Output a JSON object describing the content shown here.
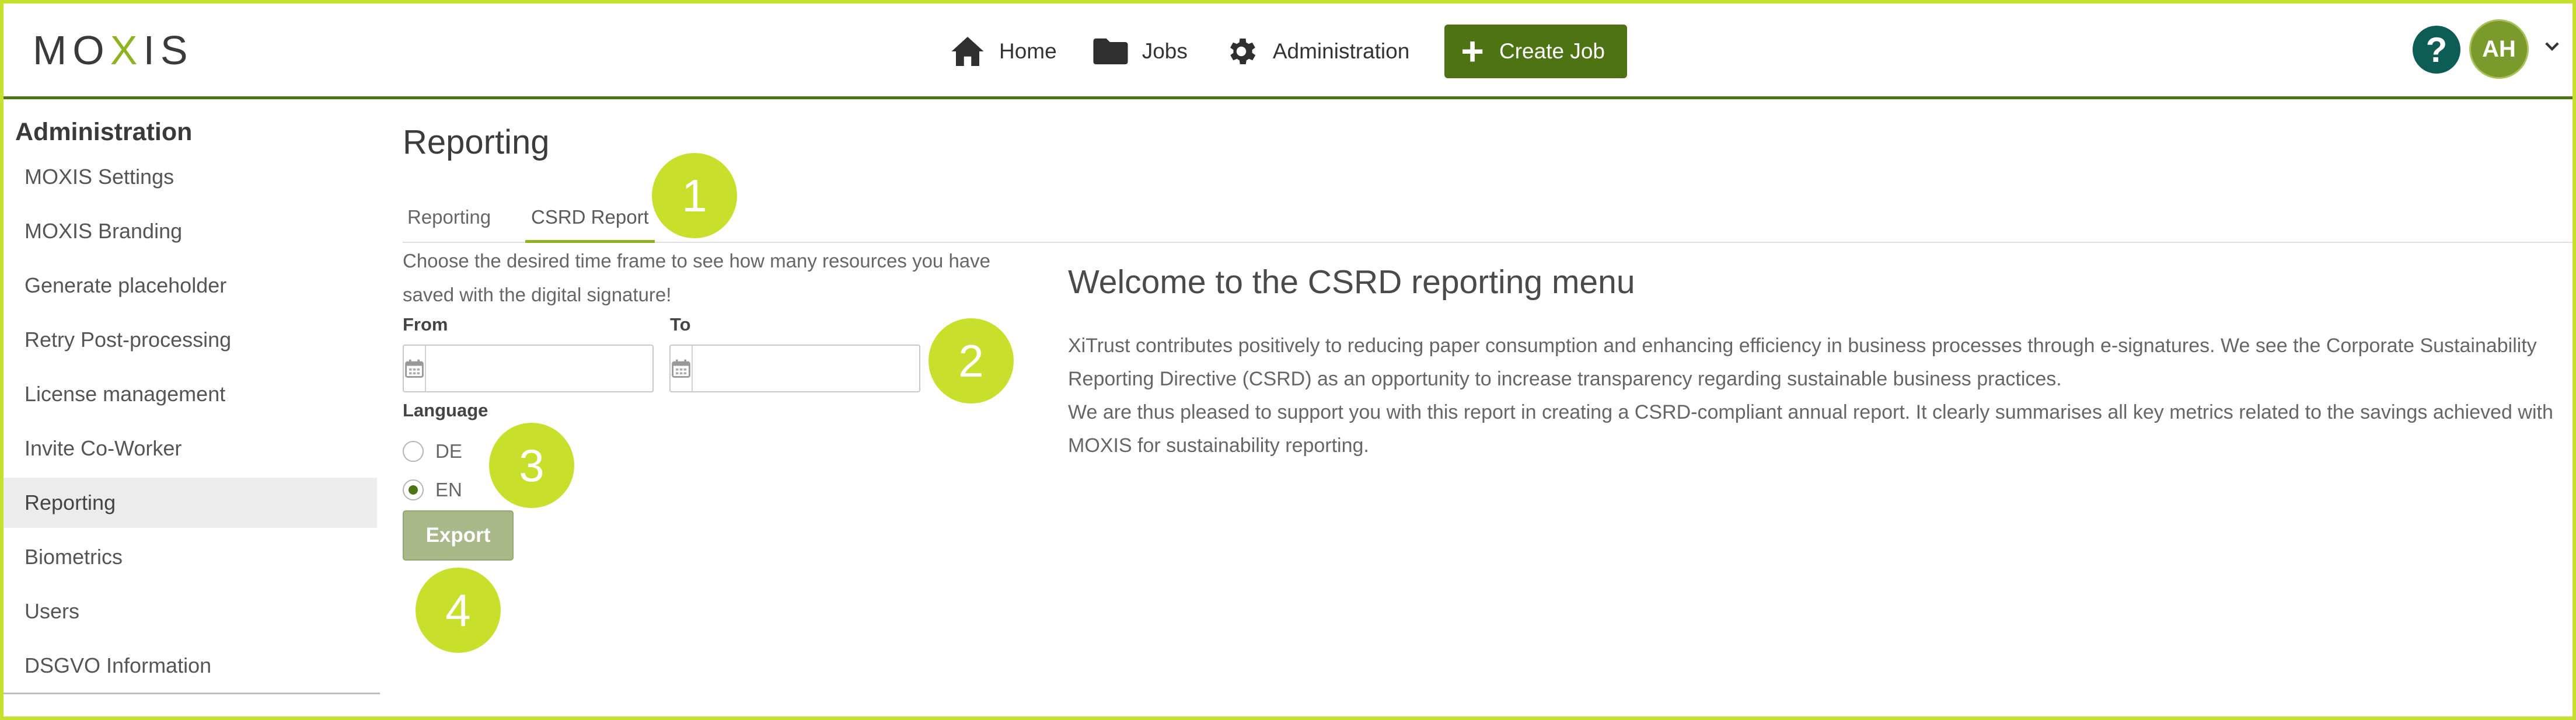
{
  "header": {
    "logo": {
      "left": "MO",
      "x": "X",
      "right": "IS"
    },
    "nav": [
      {
        "label": "Home",
        "icon": "home-icon"
      },
      {
        "label": "Jobs",
        "icon": "folder-icon"
      },
      {
        "label": "Administration",
        "icon": "gear-icon"
      }
    ],
    "create_job_label": "Create Job",
    "help_label": "?",
    "avatar_initials": "AH"
  },
  "sidebar": {
    "title": "Administration",
    "items": [
      {
        "label": "MOXIS Settings"
      },
      {
        "label": "MOXIS Branding"
      },
      {
        "label": "Generate placeholder"
      },
      {
        "label": "Retry Post-processing"
      },
      {
        "label": "License management"
      },
      {
        "label": "Invite Co-Worker"
      },
      {
        "label": "Reporting",
        "active": true
      },
      {
        "label": "Biometrics"
      },
      {
        "label": "Users"
      },
      {
        "label": "DSGVO Information"
      }
    ]
  },
  "main": {
    "title": "Reporting",
    "tabs": [
      {
        "label": "Reporting",
        "active": false
      },
      {
        "label": "CSRD Report",
        "active": true
      }
    ],
    "intro_text": "Choose the desired time frame to see how many resources you have saved with the digital signature!",
    "from_label": "From",
    "to_label": "To",
    "from_value": "",
    "to_value": "",
    "language_label": "Language",
    "languages": [
      {
        "label": "DE",
        "selected": false
      },
      {
        "label": "EN",
        "selected": true
      }
    ],
    "export_label": "Export",
    "welcome_title": "Welcome to the CSRD reporting menu",
    "welcome_p1": "XiTrust contributes positively to reducing paper consumption and enhancing efficiency in business processes through e-signatures. We see the Corporate Sustainability Reporting Directive (CSRD) as an opportunity to increase transparency regarding sustainable business practices.",
    "welcome_p2": "We are thus pleased to support you with this report in creating a CSRD-compliant annual report. It clearly summarises all key metrics related to the savings achieved with MOXIS for sustainability reporting."
  },
  "badges": [
    "1",
    "2",
    "3",
    "4"
  ],
  "colors": {
    "brand_green": "#4d7313",
    "accent_lime": "#c8e02b",
    "help_teal": "#0d5c55",
    "export_disabled": "#a9b889"
  }
}
